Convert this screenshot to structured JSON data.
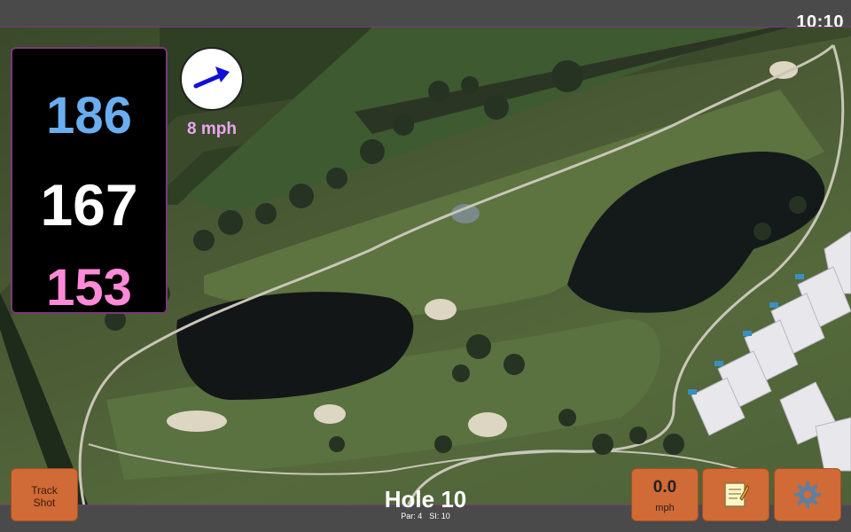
{
  "status": {
    "time": "10:10"
  },
  "distances": {
    "back": "186",
    "middle": "167",
    "front": "153"
  },
  "wind": {
    "speed": "8 mph",
    "arrow_color": "#1010d8"
  },
  "buttons": {
    "track_shot": "Track\nShot",
    "speed_value": "0.0",
    "speed_unit": "mph",
    "notes_icon": "notepad-icon",
    "settings_icon": "gear-icon"
  },
  "hole": {
    "title": "Hole 10",
    "par": "Par: 4",
    "si": "SI: 10"
  },
  "colors": {
    "back_distance": "#6aaef0",
    "middle_distance": "#ffffff",
    "front_distance": "#ff8ad8",
    "button": "#d06a36"
  }
}
